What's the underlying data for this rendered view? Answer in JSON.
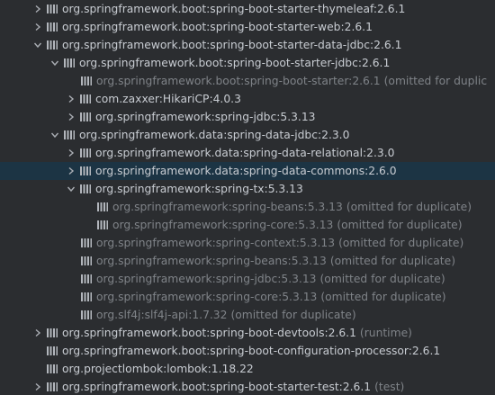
{
  "tree": {
    "rows": [
      {
        "label": "org.springframework.boot:spring-boot-starter-thymeleaf:2.6.1",
        "note": ""
      },
      {
        "label": "org.springframework.boot:spring-boot-starter-web:2.6.1",
        "note": ""
      },
      {
        "label": "org.springframework.boot:spring-boot-starter-data-jdbc:2.6.1",
        "note": ""
      },
      {
        "label": "org.springframework.boot:spring-boot-starter-jdbc:2.6.1",
        "note": ""
      },
      {
        "label": "org.springframework.boot:spring-boot-starter:2.6.1",
        "note": "(omitted for duplic"
      },
      {
        "label": "com.zaxxer:HikariCP:4.0.3",
        "note": ""
      },
      {
        "label": "org.springframework:spring-jdbc:5.3.13",
        "note": ""
      },
      {
        "label": "org.springframework.data:spring-data-jdbc:2.3.0",
        "note": ""
      },
      {
        "label": "org.springframework.data:spring-data-relational:2.3.0",
        "note": ""
      },
      {
        "label": "org.springframework.data:spring-data-commons:2.6.0",
        "note": ""
      },
      {
        "label": "org.springframework:spring-tx:5.3.13",
        "note": ""
      },
      {
        "label": "org.springframework:spring-beans:5.3.13",
        "note": "(omitted for duplicate)"
      },
      {
        "label": "org.springframework:spring-core:5.3.13",
        "note": "(omitted for duplicate)"
      },
      {
        "label": "org.springframework:spring-context:5.3.13",
        "note": "(omitted for duplicate)"
      },
      {
        "label": "org.springframework:spring-beans:5.3.13",
        "note": "(omitted for duplicate)"
      },
      {
        "label": "org.springframework:spring-jdbc:5.3.13",
        "note": "(omitted for duplicate)"
      },
      {
        "label": "org.springframework:spring-core:5.3.13",
        "note": "(omitted for duplicate)"
      },
      {
        "label": "org.slf4j:slf4j-api:1.7.32",
        "note": "(omitted for duplicate)"
      },
      {
        "label": "org.springframework.boot:spring-boot-devtools:2.6.1",
        "note": "(runtime)"
      },
      {
        "label": "org.springframework.boot:spring-boot-configuration-processor:2.6.1",
        "note": ""
      },
      {
        "label": "org.projectlombok:lombok:1.18.22",
        "note": ""
      },
      {
        "label": "org.springframework.boot:spring-boot-starter-test:2.6.1",
        "note": "(test)"
      }
    ]
  },
  "icons": {
    "expand": "chevron-right-icon",
    "collapse": "chevron-down-icon",
    "library": "library-icon"
  },
  "colors": {
    "background": "#2b2d30",
    "selection": "#1c3444",
    "text": "#c8ccd2",
    "dim_text": "#7f8388",
    "icon": "#b2b6bc"
  }
}
